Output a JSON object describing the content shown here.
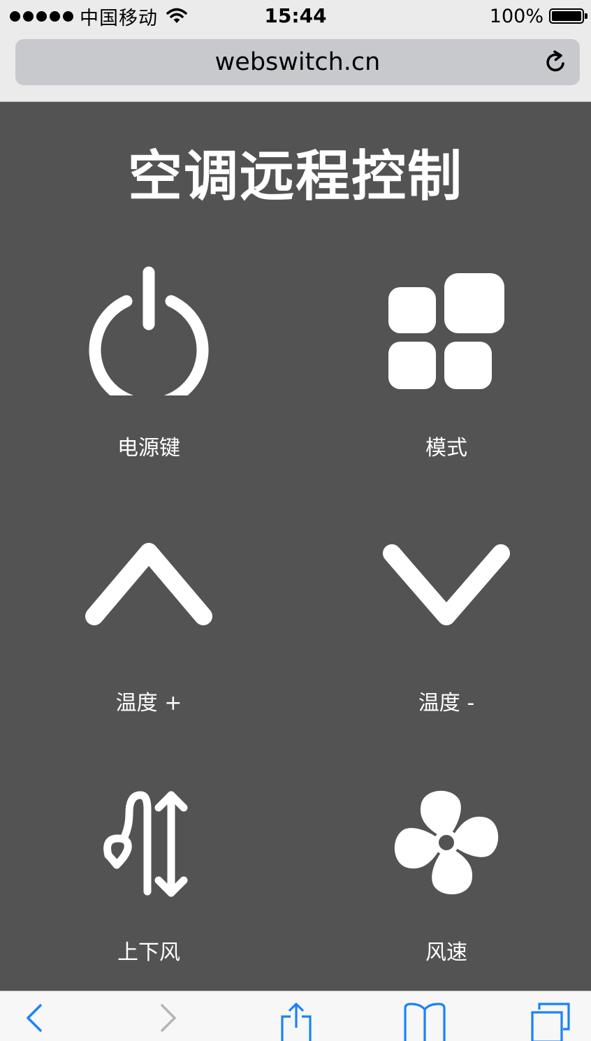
{
  "status_bar": {
    "carrier": "中国移动",
    "time": "15:44",
    "battery": "100%",
    "battery_level": 1.0,
    "signal_icon": "signal-dots-icon",
    "wifi_icon": "wifi-icon"
  },
  "browser": {
    "url": "webswitch.cn",
    "reload_icon": "reload-icon"
  },
  "page": {
    "title": "空调远程控制",
    "controls": [
      {
        "label": "电源键",
        "icon": "power-icon"
      },
      {
        "label": "模式",
        "icon": "grid-icon"
      },
      {
        "label": "温度 +",
        "icon": "chevron-up-icon"
      },
      {
        "label": "温度 -",
        "icon": "chevron-down-icon"
      },
      {
        "label": "上下风",
        "icon": "swing-icon"
      },
      {
        "label": "风速",
        "icon": "fan-icon"
      }
    ]
  },
  "toolbar": {
    "items": [
      "back-icon",
      "forward-icon",
      "share-icon",
      "bookmarks-icon",
      "tabs-icon"
    ]
  },
  "colors": {
    "background": "#535353",
    "chrome": "#ebebeb",
    "accent": "#1a82fb",
    "foreground": "#ffffff"
  }
}
